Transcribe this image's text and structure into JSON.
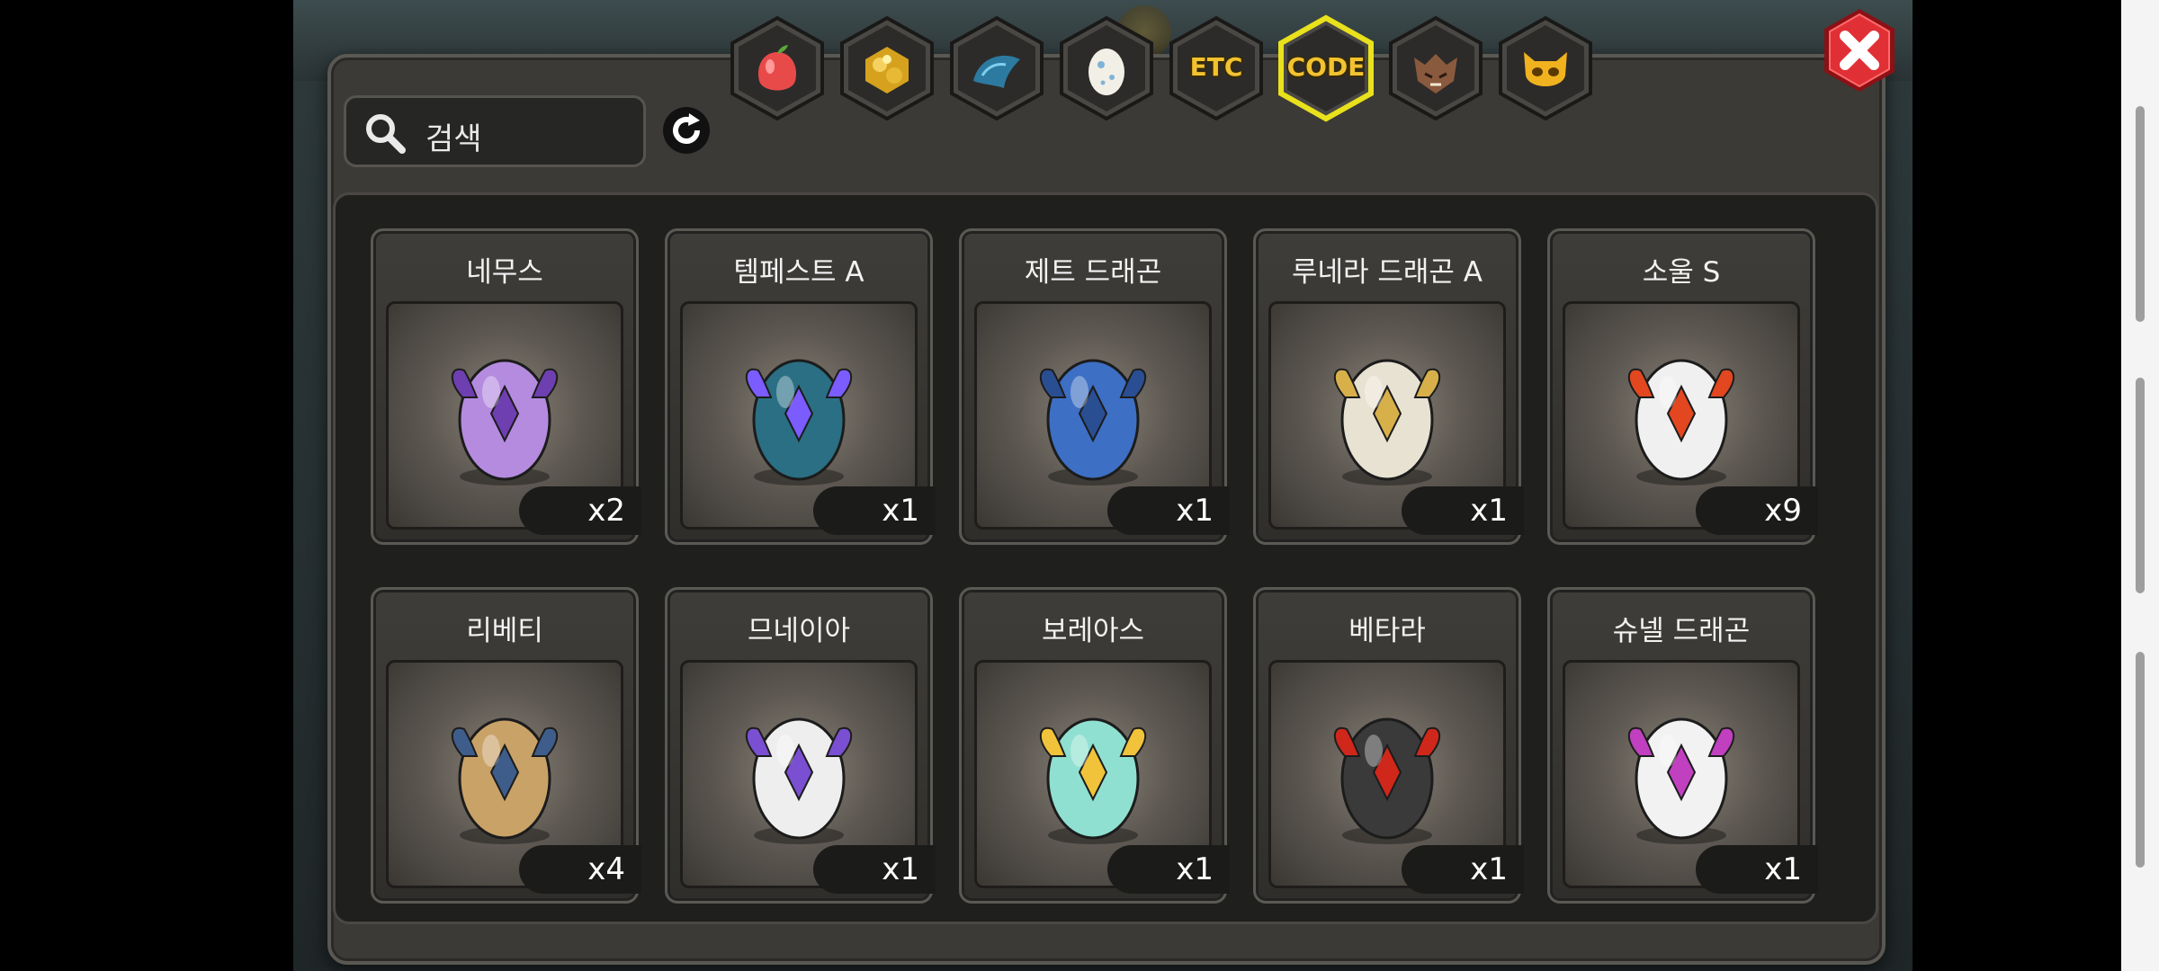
{
  "search": {
    "placeholder": "검색"
  },
  "tabs": [
    {
      "key": "fruit",
      "icon": "fruit-icon",
      "label": ""
    },
    {
      "key": "ore",
      "icon": "gold-ore-icon",
      "label": ""
    },
    {
      "key": "scale",
      "icon": "dragon-scale-icon",
      "label": ""
    },
    {
      "key": "egg",
      "icon": "egg-icon",
      "label": ""
    },
    {
      "key": "etc",
      "icon": "",
      "label": "ETC"
    },
    {
      "key": "code",
      "icon": "",
      "label": "CODE",
      "active": true
    },
    {
      "key": "beast",
      "icon": "beast-head-icon",
      "label": ""
    },
    {
      "key": "mask",
      "icon": "mask-icon",
      "label": ""
    }
  ],
  "items": [
    {
      "name": "네무스",
      "count": "x2",
      "egg_color": "#b58be0",
      "accent": "#6e3fb0"
    },
    {
      "name": "템페스트 A",
      "count": "x1",
      "egg_color": "#2a6f84",
      "accent": "#7a5cff"
    },
    {
      "name": "제트 드래곤",
      "count": "x1",
      "egg_color": "#3d6fc4",
      "accent": "#2a4e92"
    },
    {
      "name": "루네라 드래곤 A",
      "count": "x1",
      "egg_color": "#e8e2d3",
      "accent": "#d8b04a"
    },
    {
      "name": "소울 S",
      "count": "x9",
      "egg_color": "#f0f0f0",
      "accent": "#e2471f"
    },
    {
      "name": "리베티",
      "count": "x4",
      "egg_color": "#c9a268",
      "accent": "#3e5d8a"
    },
    {
      "name": "므네이아",
      "count": "x1",
      "egg_color": "#eeeeee",
      "accent": "#7a4fd2"
    },
    {
      "name": "보레아스",
      "count": "x1",
      "egg_color": "#8fe0d0",
      "accent": "#f0c33a"
    },
    {
      "name": "베타라",
      "count": "x1",
      "egg_color": "#3a3a3a",
      "accent": "#d0271b"
    },
    {
      "name": "슈넬 드래곤",
      "count": "x1",
      "egg_color": "#f2f2f2",
      "accent": "#c040c0"
    }
  ],
  "colors": {
    "active_tab_border": "#e9e11c",
    "close_red": "#d7262c",
    "panel": "#3b3a37"
  }
}
